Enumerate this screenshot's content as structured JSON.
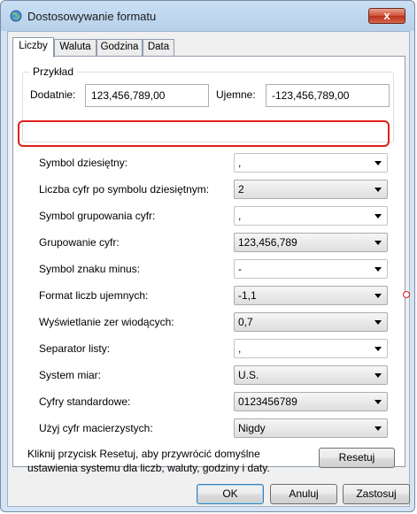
{
  "window": {
    "title": "Dostosowywanie formatu",
    "close": "x"
  },
  "tabs": [
    {
      "label": "Liczby"
    },
    {
      "label": "Waluta"
    },
    {
      "label": "Godzina"
    },
    {
      "label": "Data"
    }
  ],
  "example": {
    "group_label": "Przykład",
    "positive_label": "Dodatnie:",
    "positive_value": "123,456,789,00",
    "negative_label": "Ujemne:",
    "negative_value": "-123,456,789,00"
  },
  "settings": [
    {
      "label": "Symbol dziesiętny:",
      "value": ","
    },
    {
      "label": "Liczba cyfr po symbolu dziesiętnym:",
      "value": "2"
    },
    {
      "label": "Symbol grupowania cyfr:",
      "value": ","
    },
    {
      "label": "Grupowanie cyfr:",
      "value": "123,456,789"
    },
    {
      "label": "Symbol znaku minus:",
      "value": "-"
    },
    {
      "label": "Format liczb ujemnych:",
      "value": "-1,1"
    },
    {
      "label": "Wyświetlanie zer wiodących:",
      "value": "0,7"
    },
    {
      "label": "Separator listy:",
      "value": ","
    },
    {
      "label": "System miar:",
      "value": "U.S."
    },
    {
      "label": "Cyfry standardowe:",
      "value": "0123456789"
    },
    {
      "label": "Użyj cyfr macierzystych:",
      "value": "Nigdy"
    }
  ],
  "info_text": "Kliknij przycisk Resetuj, aby przywrócić domyślne ustawienia systemu dla liczb, waluty, godziny i daty.",
  "buttons": {
    "reset": "Resetuj",
    "ok": "OK",
    "cancel": "Anuluj",
    "apply": "Zastosuj"
  },
  "colors": {
    "highlight": "#e0201a",
    "title_bar": "#c9dff3"
  }
}
